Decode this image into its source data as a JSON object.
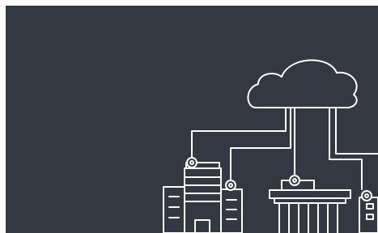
{
  "hero": {
    "background_color": "#343842",
    "line_color": "#ffffff",
    "page_margin_color": "#ffffff",
    "illustration": {
      "icons": [
        "cloud-icon",
        "office-building-icon",
        "tall-building-icon",
        "server-rack-icon",
        "network-node-icon"
      ]
    }
  }
}
